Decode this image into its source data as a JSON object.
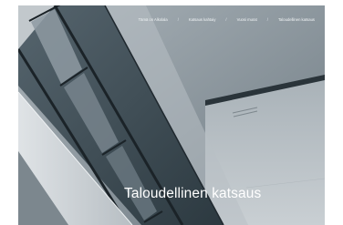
{
  "breadcrumb": {
    "items": [
      {
        "label": "Tämä on Alkolala"
      },
      {
        "label": "Katsaus kahtaiy"
      },
      {
        "label": "Vuosi murat"
      },
      {
        "label": "Taloudellinen katsaus"
      }
    ],
    "separator": "/"
  },
  "hero": {
    "title": "Taloudellinen katsaus",
    "image_icon": "building-facade-photo"
  },
  "colors": {
    "sky": "#9aa5ac",
    "wall_light": "#d2d7db",
    "wall_shadow": "#7f8a91",
    "glass": "#3e4d57",
    "frame": "#1e272d",
    "text": "#ffffff"
  }
}
